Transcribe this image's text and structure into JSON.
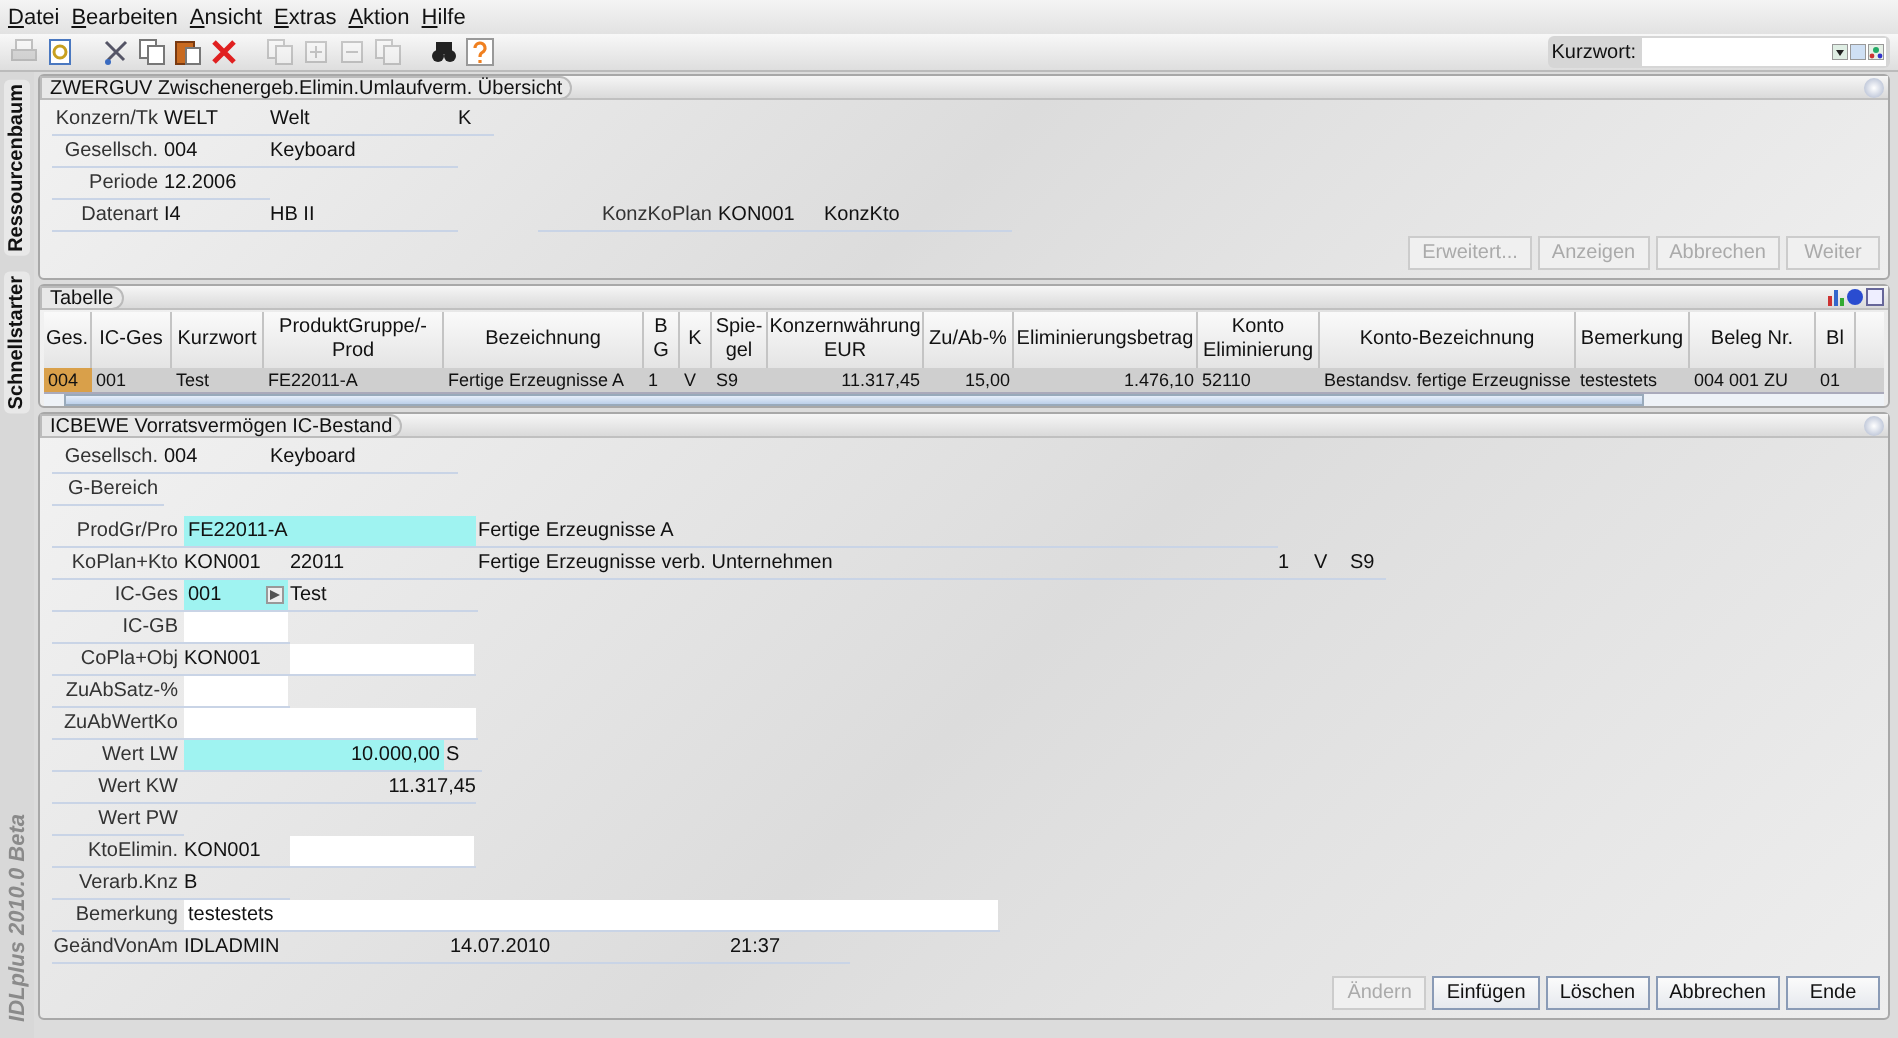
{
  "menu": [
    "Datei",
    "Bearbeiten",
    "Ansicht",
    "Extras",
    "Aktion",
    "Hilfe"
  ],
  "toolbar": [
    {
      "kind": "printer",
      "disabled": true
    },
    {
      "kind": "preview",
      "disabled": false
    },
    {
      "kind": "cut",
      "disabled": false
    },
    {
      "kind": "copy",
      "disabled": false
    },
    {
      "kind": "paste",
      "disabled": false
    },
    {
      "kind": "delete",
      "disabled": false
    },
    {
      "kind": "copy",
      "disabled": true
    },
    {
      "kind": "plus",
      "disabled": true
    },
    {
      "kind": "minus",
      "disabled": true
    },
    {
      "kind": "copy",
      "disabled": true
    },
    {
      "kind": "binoculars",
      "disabled": false
    },
    {
      "kind": "help",
      "disabled": false
    }
  ],
  "search": {
    "label": "Kurzwort:"
  },
  "side_tabs": [
    {
      "label": "Ressourcenbaum"
    },
    {
      "label": "Schnellstarter"
    }
  ],
  "brand": "IDLplus 2010.0 Beta",
  "overview": {
    "title": "ZWERGUV Zwischenergeb.Elimin.Umlaufverm. Übersicht",
    "rows": [
      {
        "label": "Konzern/Tk",
        "cells": [
          {
            "kind": "code",
            "value": "WELT"
          },
          {
            "kind": "name",
            "value": "Welt"
          },
          {
            "kind": "flag",
            "value": "K"
          }
        ]
      },
      {
        "label": "Gesellsch.",
        "cells": [
          {
            "kind": "code",
            "value": "004"
          },
          {
            "kind": "name",
            "value": "Keyboard"
          }
        ]
      },
      {
        "label": "Periode",
        "cells": [
          {
            "kind": "code",
            "value": "12.2006"
          }
        ]
      },
      {
        "label": "Datenart",
        "cells": [
          {
            "kind": "code",
            "value": "I4"
          },
          {
            "kind": "name",
            "value": "HB II"
          }
        ],
        "side": {
          "label": "KonzKoPlan",
          "cells": [
            {
              "kind": "code",
              "value": "KON001"
            },
            {
              "kind": "name",
              "value": "KonzKto"
            }
          ]
        }
      }
    ],
    "buttons": [
      {
        "label": "Erweitert...",
        "disabled": true
      },
      {
        "label": "Anzeigen",
        "disabled": true
      },
      {
        "label": "Abbrechen",
        "disabled": true
      },
      {
        "label": "Weiter",
        "disabled": true
      }
    ]
  },
  "table": {
    "title": "Tabelle",
    "columns": [
      {
        "label": "Ges.",
        "kind": "text"
      },
      {
        "label": "IC-Ges",
        "kind": "text"
      },
      {
        "label": "Kurzwort",
        "kind": "text"
      },
      {
        "label": "ProduktGruppe/-Prod",
        "kind": "text"
      },
      {
        "label": "Bezeichnung",
        "kind": "text"
      },
      {
        "label": "B G",
        "kind": "text"
      },
      {
        "label": "K",
        "kind": "text"
      },
      {
        "label": "Spie-gel",
        "kind": "text"
      },
      {
        "label": "Konzernwährung EUR",
        "kind": "number"
      },
      {
        "label": "Zu/Ab-%",
        "kind": "number"
      },
      {
        "label": "Eliminierungsbetrag",
        "kind": "number"
      },
      {
        "label": "Konto Eliminierung",
        "kind": "text"
      },
      {
        "label": "Konto-Bezeichnung",
        "kind": "text"
      },
      {
        "label": "Bemerkung",
        "kind": "text"
      },
      {
        "label": "Beleg Nr.",
        "kind": "text"
      },
      {
        "label": "Bl",
        "kind": "text"
      }
    ],
    "rows": [
      {
        "selected": true,
        "cells": [
          {
            "value": "004",
            "active": true
          },
          {
            "value": "001",
            "active": false
          },
          {
            "value": "Test",
            "active": false
          },
          {
            "value": "FE22011-A",
            "active": false
          },
          {
            "value": "Fertige Erzeugnisse A",
            "active": false
          },
          {
            "value": "1",
            "active": false
          },
          {
            "value": "V",
            "active": false
          },
          {
            "value": "S9",
            "active": false
          },
          {
            "value": "11.317,45",
            "active": false
          },
          {
            "value": "15,00",
            "active": false
          },
          {
            "value": "1.476,10",
            "active": false
          },
          {
            "value": "52110",
            "active": false
          },
          {
            "value": "Bestandsv. fertige Erzeugnisse",
            "active": false
          },
          {
            "value": "testestets",
            "active": false
          },
          {
            "value": "004 001 ZU",
            "active": false
          },
          {
            "value": "01",
            "active": false
          }
        ]
      }
    ]
  },
  "detail": {
    "title": "ICBEWE Vorratsvermögen IC-Bestand",
    "header_rows": [
      {
        "label": "Gesellsch.",
        "cells": [
          {
            "kind": "code",
            "value": "004"
          },
          {
            "kind": "name",
            "value": "Keyboard"
          }
        ]
      },
      {
        "label": "G-Bereich",
        "cells": []
      }
    ],
    "rows": [
      {
        "label": "ProdGr/Pro",
        "cells": [
          {
            "kind": "widefield",
            "value": "FE22011-A",
            "highlighted": true
          },
          {
            "kind": "desc",
            "value": "Fertige Erzeugnisse A"
          }
        ]
      },
      {
        "label": "KoPlan+Kto",
        "cells": [
          {
            "kind": "code",
            "value": "KON001"
          },
          {
            "kind": "name",
            "value": "22011"
          },
          {
            "kind": "desc",
            "value": "Fertige Erzeugnisse verb. Unternehmen"
          },
          {
            "kind": "flag",
            "value": "1"
          },
          {
            "kind": "flag",
            "value": "V"
          },
          {
            "kind": "flag",
            "value": "S9"
          }
        ]
      },
      {
        "label": "IC-Ges",
        "cells": [
          {
            "kind": "lookup",
            "value": "001",
            "highlighted": true
          },
          {
            "kind": "name",
            "value": "Test"
          }
        ]
      },
      {
        "label": "IC-GB",
        "cells": [
          {
            "kind": "shortfield",
            "highlighted": false
          }
        ]
      },
      {
        "label": "CoPla+Obj",
        "cells": [
          {
            "kind": "code",
            "value": "KON001"
          },
          {
            "kind": "field",
            "highlighted": false
          }
        ]
      },
      {
        "label": "ZuAbSatz-%",
        "cells": [
          {
            "kind": "shortfield",
            "highlighted": false
          }
        ]
      },
      {
        "label": "ZuAbWertKo",
        "cells": [
          {
            "kind": "widefield",
            "highlighted": false
          }
        ]
      },
      {
        "label": "Wert LW",
        "cells": [
          {
            "kind": "amountfield",
            "value": "10.000,00",
            "highlighted": true
          },
          {
            "kind": "flag",
            "value": "S"
          }
        ]
      },
      {
        "label": "Wert KW",
        "cells": [
          {
            "kind": "amount",
            "value": "11.317,45"
          }
        ]
      },
      {
        "label": "Wert PW",
        "cells": []
      },
      {
        "label": "KtoElimin.",
        "cells": [
          {
            "kind": "code",
            "value": "KON001"
          },
          {
            "kind": "field",
            "highlighted": false
          }
        ]
      },
      {
        "label": "Verarb.Knz",
        "cells": [
          {
            "kind": "code",
            "value": "B"
          }
        ]
      },
      {
        "label": "Bemerkung",
        "cells": [
          {
            "kind": "longfield",
            "value": "testestets",
            "highlighted": false
          }
        ]
      },
      {
        "label": "GeändVonAm",
        "cells": [
          {
            "kind": "user",
            "value": "IDLADMIN"
          },
          {
            "kind": "date",
            "value": "14.07.2010"
          },
          {
            "kind": "time",
            "value": "21:37"
          }
        ]
      }
    ],
    "buttons": [
      {
        "label": "Ändern",
        "disabled": true
      },
      {
        "label": "Einfügen",
        "disabled": false
      },
      {
        "label": "Löschen",
        "disabled": false
      },
      {
        "label": "Abbrechen",
        "disabled": false
      },
      {
        "label": "Ende",
        "disabled": false
      }
    ]
  }
}
